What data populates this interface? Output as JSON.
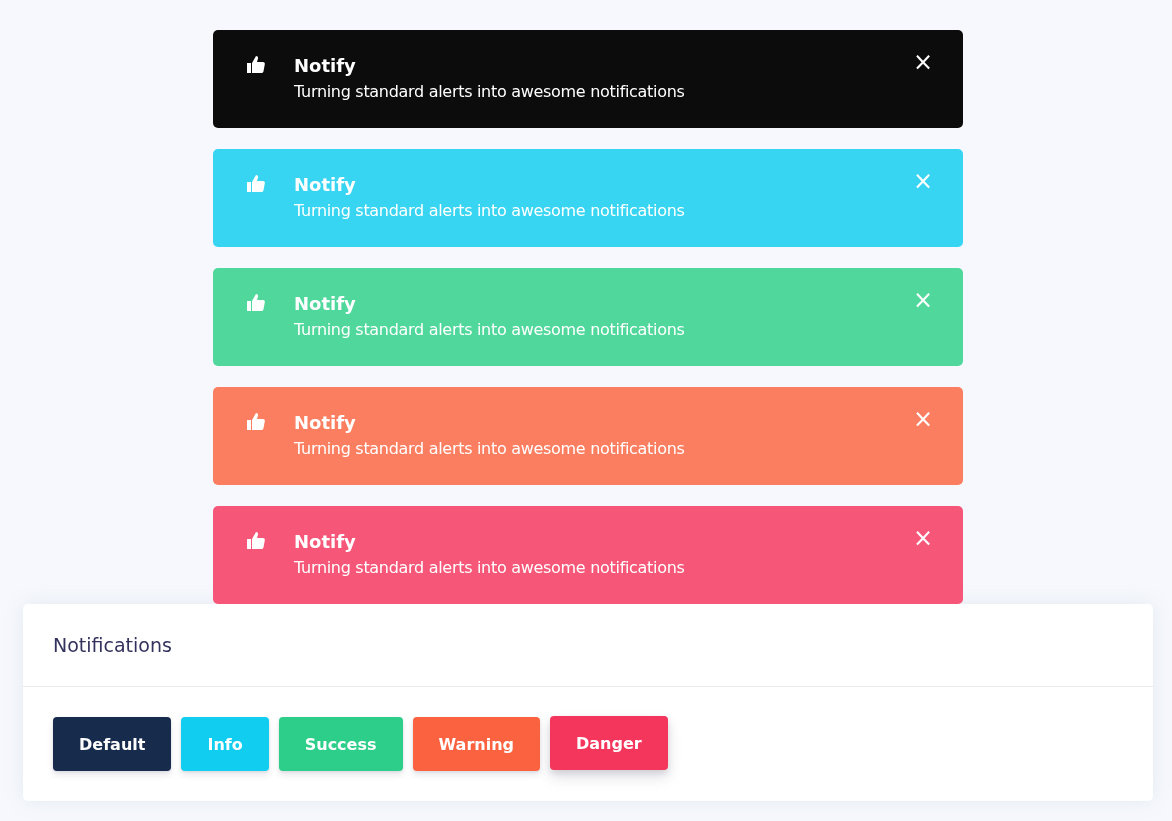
{
  "notifications": [
    {
      "title": "Notify",
      "message": "Turning standard alerts into awesome notifications",
      "close": "×",
      "color": "#0c0c0c"
    },
    {
      "title": "Notify",
      "message": "Turning standard alerts into awesome notifications",
      "close": "×",
      "color": "#38d5f2"
    },
    {
      "title": "Notify",
      "message": "Turning standard alerts into awesome notifications",
      "close": "×",
      "color": "#50d89c"
    },
    {
      "title": "Notify",
      "message": "Turning standard alerts into awesome notifications",
      "close": "×",
      "color": "#fc7e60"
    },
    {
      "title": "Notify",
      "message": "Turning standard alerts into awesome notifications",
      "close": "×",
      "color": "#f65778"
    }
  ],
  "card": {
    "title": "Notifications",
    "buttons": [
      {
        "label": "Default",
        "color": "#172b4d",
        "hovered": false
      },
      {
        "label": "Info",
        "color": "#11cdef",
        "hovered": false
      },
      {
        "label": "Success",
        "color": "#2dce89",
        "hovered": false
      },
      {
        "label": "Warning",
        "color": "#fb6340",
        "hovered": false
      },
      {
        "label": "Danger",
        "color": "#f5365c",
        "hovered": true
      }
    ]
  }
}
